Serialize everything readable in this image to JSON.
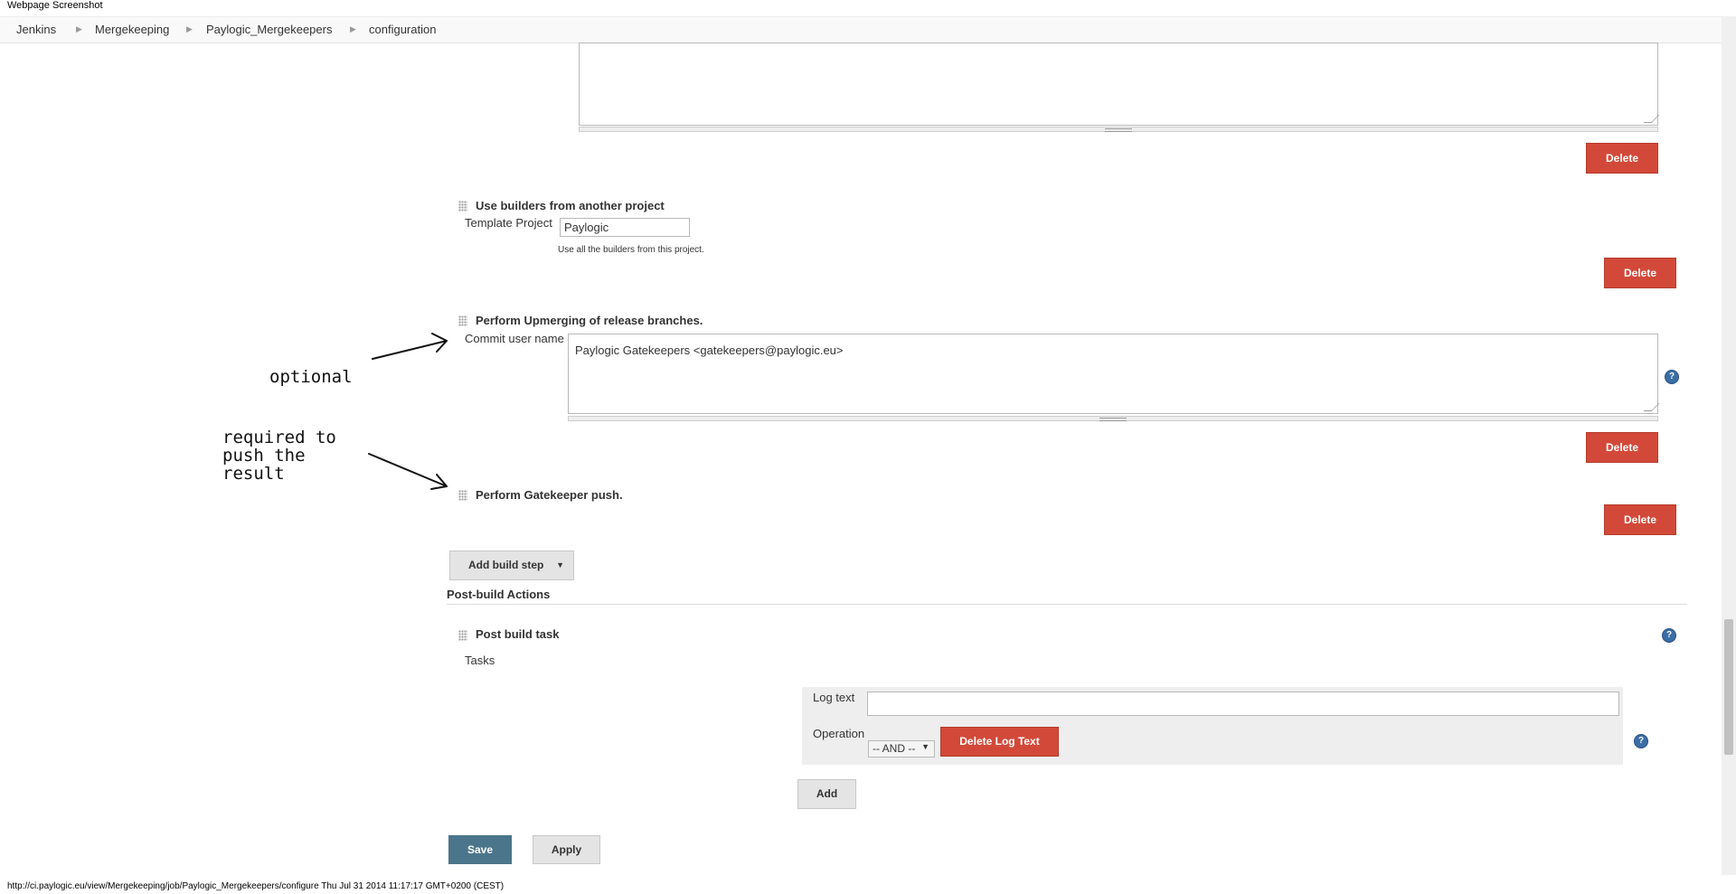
{
  "window_title": "Webpage Screenshot",
  "breadcrumbs": [
    "Jenkins",
    "Mergekeeping",
    "Paylogic_Mergekeepers",
    "configuration"
  ],
  "delete_label": "Delete",
  "builders_section": {
    "title": "Use builders from another project",
    "template_label": "Template Project",
    "template_value": "Paylogic",
    "hint": "Use all the builders from this project."
  },
  "upmerge_section": {
    "title": "Perform Upmerging of release branches.",
    "commit_label": "Commit user name",
    "commit_value": "Paylogic Gatekeepers <gatekeepers@paylogic.eu>"
  },
  "push_section": {
    "title": "Perform Gatekeeper push."
  },
  "add_build_step_label": "Add build step",
  "post_build": {
    "heading": "Post-build Actions",
    "task_title": "Post build task",
    "tasks_label": "Tasks",
    "log_text_label": "Log text",
    "log_text_value": "",
    "operation_label": "Operation",
    "operation_value": "-- AND --",
    "delete_log_text_label": "Delete Log Text",
    "add_label": "Add"
  },
  "save_label": "Save",
  "apply_label": "Apply",
  "annotations": {
    "optional": "optional",
    "required": "required to\npush the\nresult"
  },
  "status_bar": "http://ci.paylogic.eu/view/Mergekeeping/job/Paylogic_Mergekeepers/configure Thu Jul 31 2014 11:17:17 GMT+0200 (CEST)",
  "colors": {
    "delete_red": "#d24939",
    "save_blue": "#4b758b",
    "help_blue": "#3a6ea5"
  },
  "icons": [
    "chevron-right-icon",
    "drag-handle-icon",
    "help-icon",
    "dropdown-arrow-icon"
  ]
}
